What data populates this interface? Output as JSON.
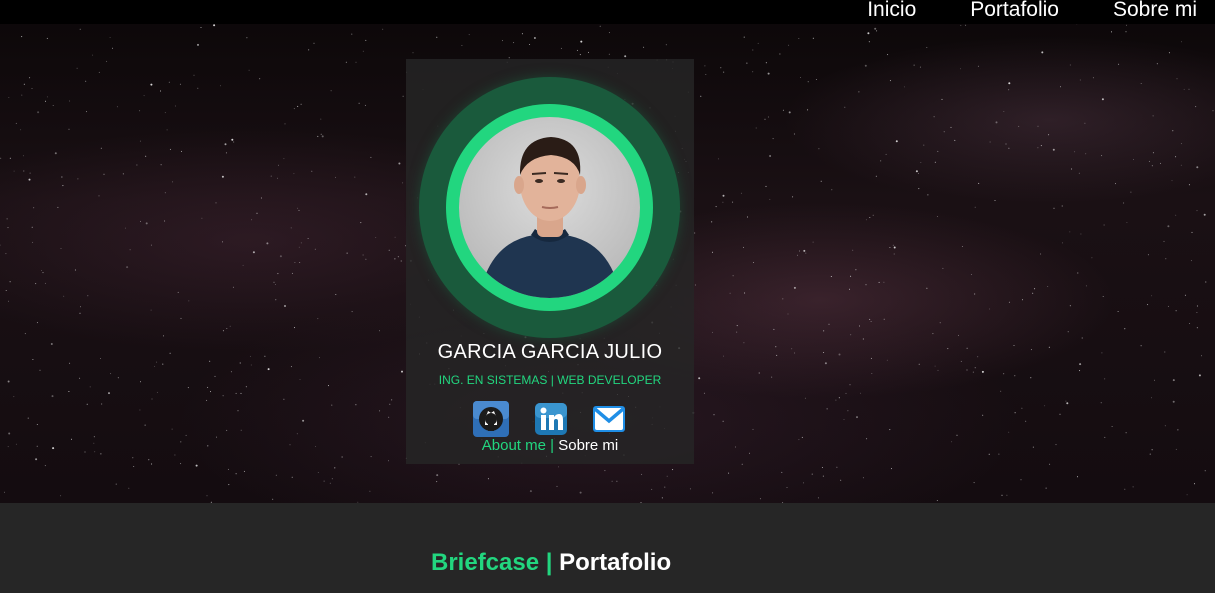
{
  "nav": {
    "links": [
      "Inicio",
      "Portafolio",
      "Sobre mi"
    ]
  },
  "profile": {
    "name": "GARCIA GARCIA JULIO",
    "subtitle": "ING. EN SISTEMAS | WEB DEVELOPER",
    "about_en": "About me",
    "separator": "|",
    "about_es": "Sobre mi"
  },
  "socials": {
    "icons": [
      "github-icon",
      "linkedin-icon",
      "mail-icon"
    ]
  },
  "footer": {
    "title_en": "Briefcase",
    "separator": "|",
    "title_es": "Portafolio"
  },
  "colors": {
    "accent": "#22d67f",
    "ring_outer": "#1a5a3c",
    "card_bg": "#262626",
    "footer_bg": "#262626"
  }
}
